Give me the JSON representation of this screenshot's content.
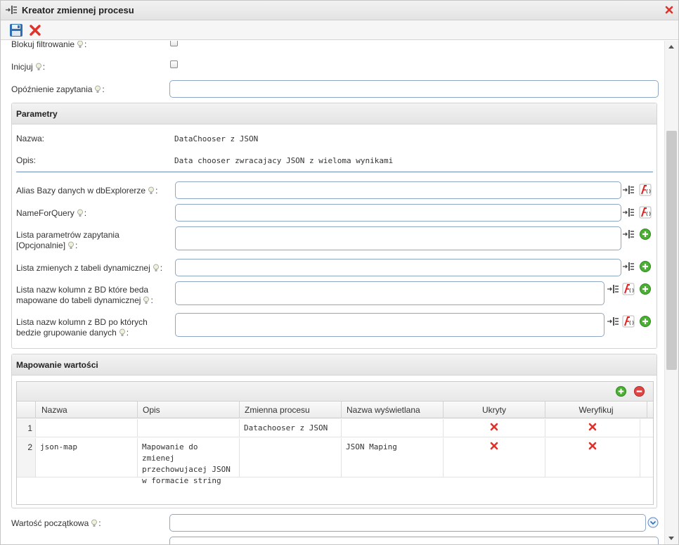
{
  "window": {
    "title": "Kreator zmiennej procesu"
  },
  "fields_top": {
    "blokuj_label": "Blokuj filtrowanie",
    "inicjuj_label": "Inicjuj",
    "opoznienie_label": "Opóźnienie zapytania",
    "opoznienie_value": ""
  },
  "parametry": {
    "title": "Parametry",
    "nazwa_label": "Nazwa:",
    "nazwa_value": "DataChooser z JSON",
    "opis_label": "Opis:",
    "opis_value": "Data chooser zwracajacy JSON z wieloma wynikami",
    "fields": [
      {
        "label": "Alias Bazy danych w dbExplorerze",
        "value": ""
      },
      {
        "label": "NameForQuery",
        "value": ""
      },
      {
        "label": "Lista parametrów zapytania [Opcjonalnie]",
        "value": ""
      },
      {
        "label": "Lista zmienych z tabeli dynamicznej",
        "value": ""
      },
      {
        "label": "Lista nazw kolumn z BD które beda mapowane do tabeli dynamicznej",
        "value": ""
      },
      {
        "label": "Lista nazw kolumn z BD po których bedzie grupowanie danych",
        "value": ""
      }
    ]
  },
  "mapowanie": {
    "title": "Mapowanie wartości",
    "columns": [
      "Nazwa",
      "Opis",
      "Zmienna procesu",
      "Nazwa wyświetlana",
      "Ukryty",
      "Weryfikuj"
    ],
    "rows": [
      {
        "num": "1",
        "nazwa": "",
        "opis": "",
        "zmienna": "Datachooser z JSON",
        "wyswietlana": "",
        "ukryty": false,
        "weryfikuj": false
      },
      {
        "num": "2",
        "nazwa": "json-map",
        "opis": "Mapowanie do zmienej przechowujacej JSON w formacie string",
        "zmienna": "",
        "wyswietlana": "JSON Maping",
        "ukryty": false,
        "weryfikuj": false
      }
    ]
  },
  "fields_bottom": {
    "wartosc_label": "Wartość początkowa",
    "wartosc_value": ""
  },
  "colors": {
    "input_border": "#8fa6c4",
    "red_x": "#e0312b",
    "green_add": "#4caf33",
    "red_remove": "#e04545"
  }
}
